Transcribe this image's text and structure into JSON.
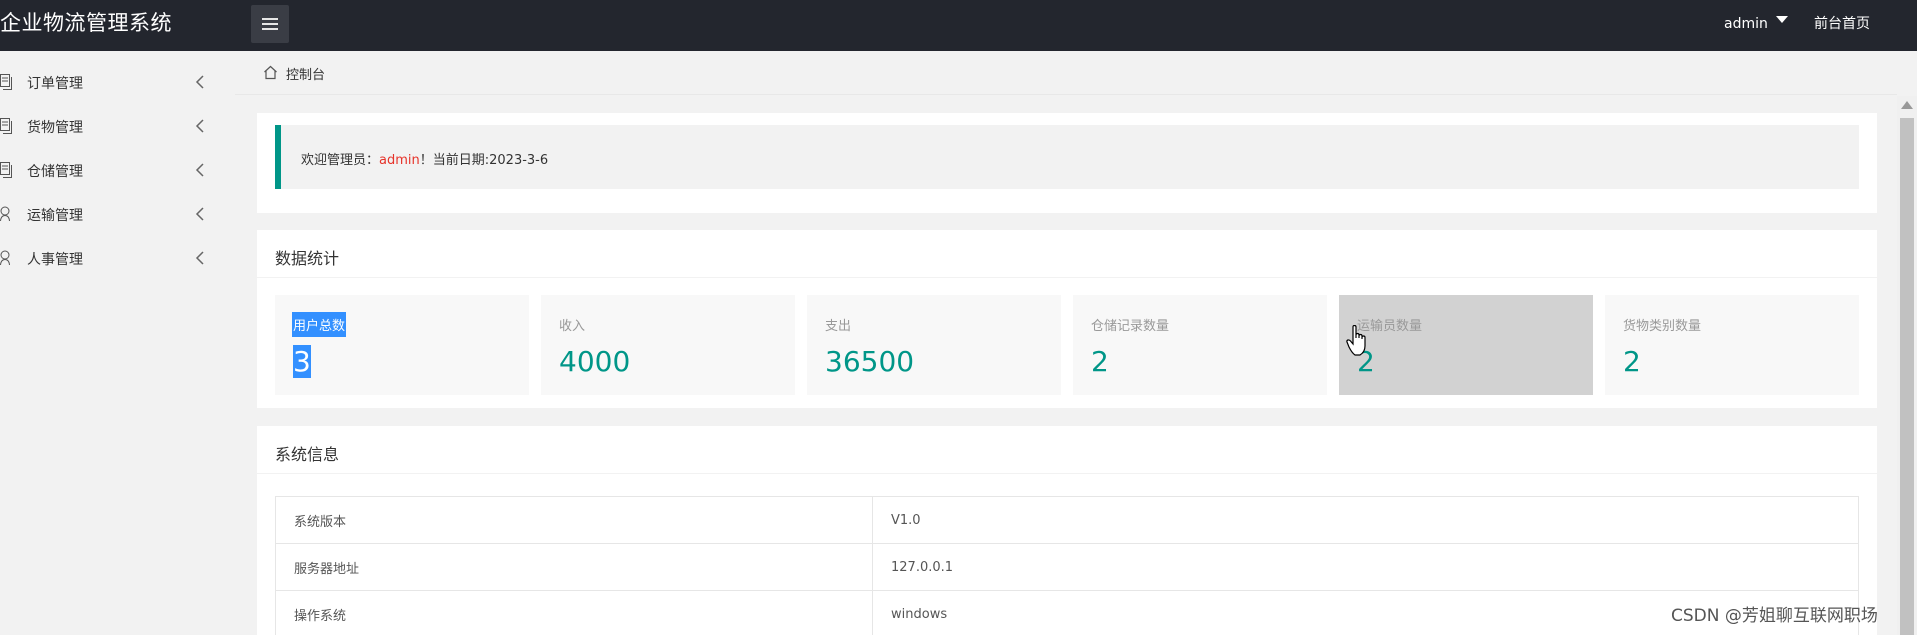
{
  "header": {
    "title": "企业物流管理系统",
    "user": "admin",
    "front_link": "前台首页"
  },
  "sidebar": {
    "items": [
      {
        "label": "订单管理",
        "icon": "document-icon"
      },
      {
        "label": "货物管理",
        "icon": "document-icon"
      },
      {
        "label": "仓储管理",
        "icon": "document-icon"
      },
      {
        "label": "运输管理",
        "icon": "user-icon"
      },
      {
        "label": "人事管理",
        "icon": "user-icon"
      }
    ]
  },
  "breadcrumb": {
    "label": "控制台"
  },
  "welcome": {
    "prefix": "欢迎管理员：",
    "name": "admin",
    "suffix": "！当前日期:2023-3-6"
  },
  "stats": {
    "title": "数据统计",
    "items": [
      {
        "label": "用户总数",
        "value": "3"
      },
      {
        "label": "收入",
        "value": "4000"
      },
      {
        "label": "支出",
        "value": "36500"
      },
      {
        "label": "仓储记录数量",
        "value": "2"
      },
      {
        "label": "运输员数量",
        "value": "2"
      },
      {
        "label": "货物类别数量",
        "value": "2"
      }
    ]
  },
  "system": {
    "title": "系统信息",
    "rows": [
      {
        "key": "系统版本",
        "value": "V1.0"
      },
      {
        "key": "服务器地址",
        "value": "127.0.0.1"
      },
      {
        "key": "操作系统",
        "value": "windows"
      }
    ]
  },
  "watermark": "CSDN @芳姐聊互联网职场",
  "colors": {
    "topbar": "#23262e",
    "accent": "#009688",
    "highlight": "#3390ff",
    "name_red": "#e6332a"
  }
}
